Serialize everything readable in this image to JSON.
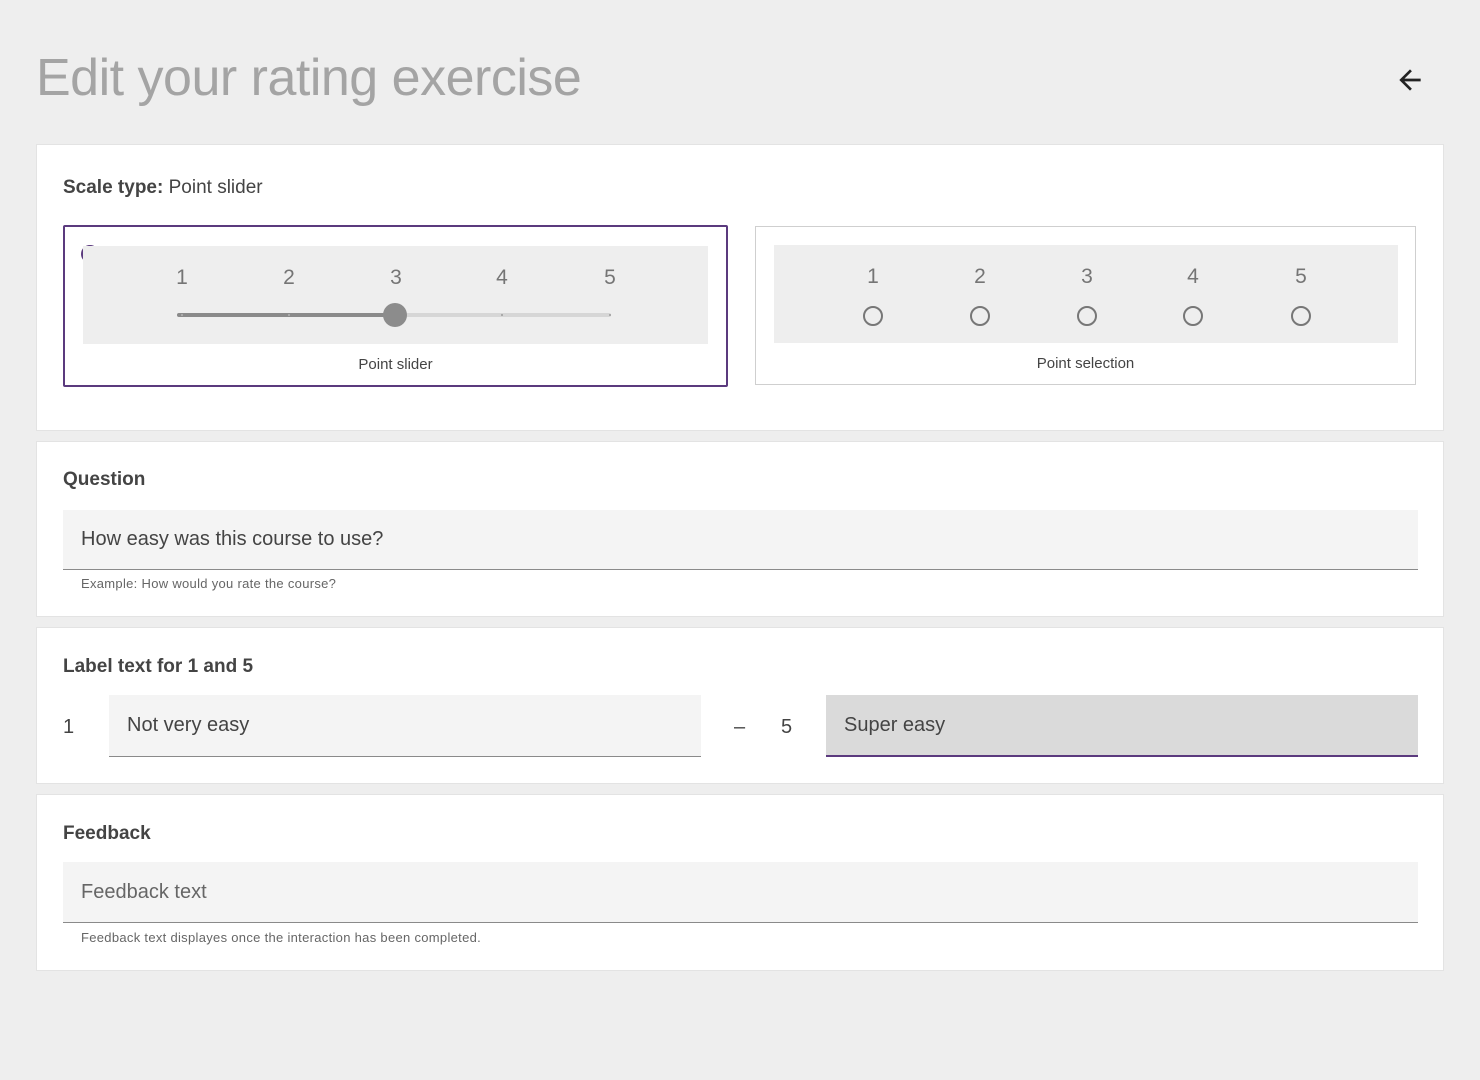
{
  "page": {
    "title": "Edit your rating exercise"
  },
  "scale": {
    "heading_bold": "Scale type:",
    "heading_value": " Point slider",
    "options": [
      {
        "caption": "Point slider",
        "selected": true,
        "numbers": [
          "1",
          "2",
          "3",
          "4",
          "5"
        ],
        "slider_value": 3
      },
      {
        "caption": "Point selection",
        "selected": false,
        "numbers": [
          "1",
          "2",
          "3",
          "4",
          "5"
        ]
      }
    ]
  },
  "question": {
    "heading": "Question",
    "value": "How easy was this course to use?",
    "hint": "Example: How would you rate the course?"
  },
  "labels": {
    "heading": "Label text for 1 and 5",
    "low_number": "1",
    "low_value": "Not very easy",
    "separator": "–",
    "high_number": "5",
    "high_value": "Super easy"
  },
  "feedback": {
    "heading": "Feedback",
    "placeholder": "Feedback text",
    "hint": "Feedback text displayes once the interaction has been completed."
  },
  "colors": {
    "accent": "#5b3a7e",
    "background": "#eeeeee"
  },
  "icons": {
    "back": "arrow-left-icon",
    "check": "check-circle-icon"
  }
}
